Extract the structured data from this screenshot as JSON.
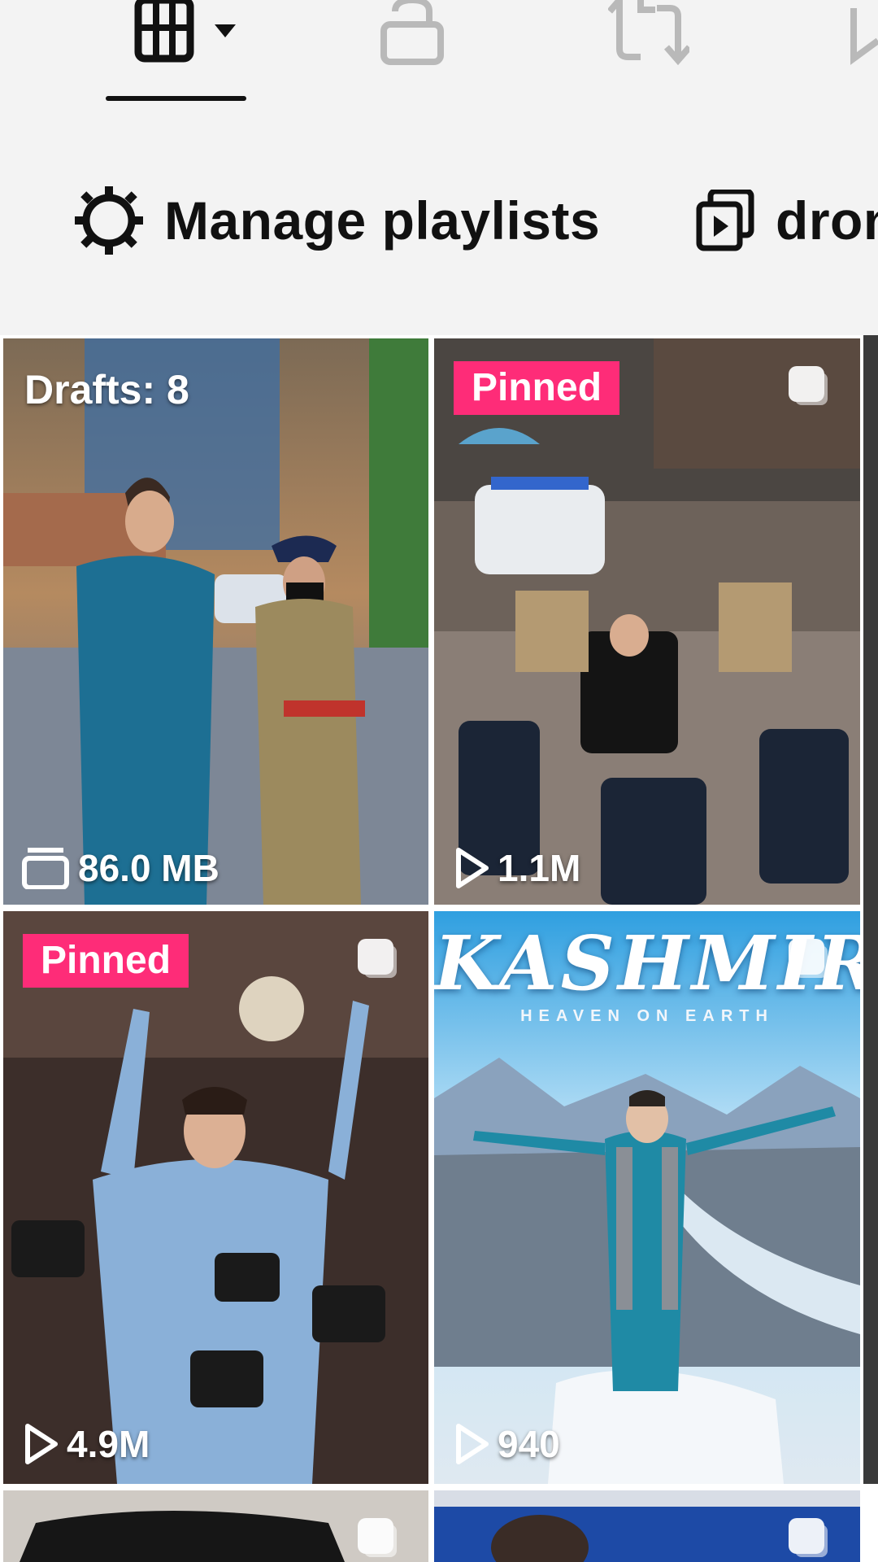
{
  "tabs": [
    {
      "icon": "grid-icon",
      "active": true,
      "has_dropdown": true
    },
    {
      "icon": "lock-icon",
      "active": false
    },
    {
      "icon": "repost-icon",
      "active": false
    },
    {
      "icon": "bookmark-icon",
      "active": false
    }
  ],
  "subbar": {
    "manage_label": "Manage playlists",
    "manage_icon": "gear-icon",
    "playlist_label": "dron",
    "playlist_icon": "playlist-icon"
  },
  "colors": {
    "pinned_badge": "#fe2c78",
    "background": "#f3f3f3",
    "text": "#111111"
  },
  "videos": [
    {
      "badge": "Drafts: 8",
      "stat_icon": "drafts-icon",
      "stat": "86.0 MB"
    },
    {
      "badge": "Pinned",
      "stat_icon": "play-icon",
      "stat": "1.1M"
    },
    {
      "badge": "Pinned",
      "stat_icon": "play-icon",
      "stat": "4.9M"
    },
    {
      "overlay_title": "KASHMIR",
      "overlay_subtitle": "HEAVEN ON EARTH",
      "stat_icon": "play-icon",
      "stat": "940"
    }
  ]
}
